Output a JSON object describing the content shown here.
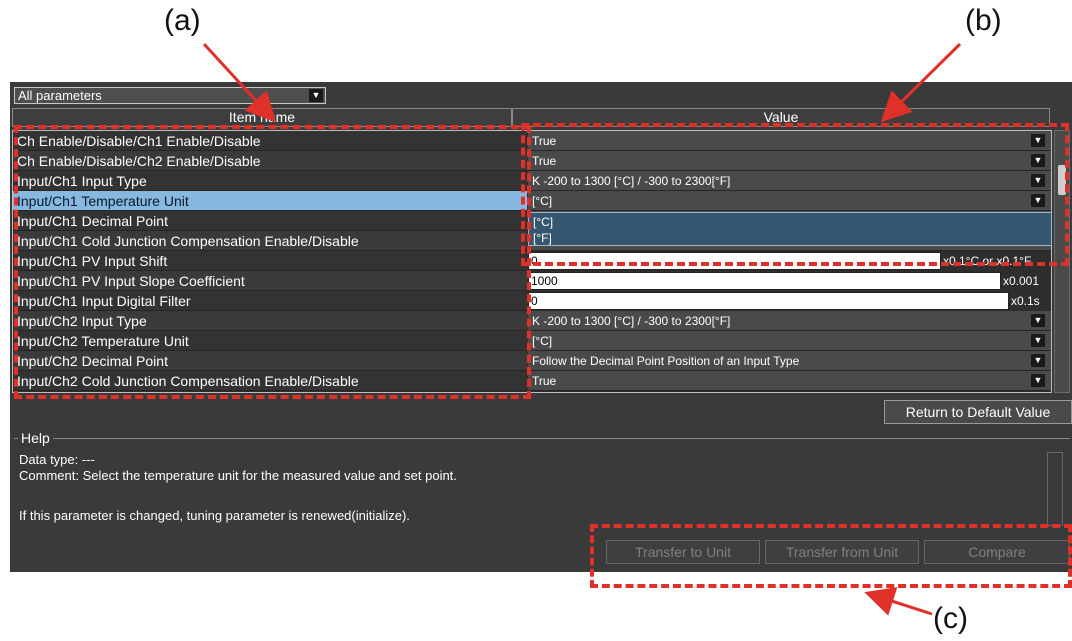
{
  "callouts": {
    "a": "(a)",
    "b": "(b)",
    "c": "(c)"
  },
  "filter": {
    "value": "All parameters",
    "arrow_icon": "chevron-down-icon"
  },
  "columns": {
    "item_name": "Item name",
    "value": "Value"
  },
  "rows": [
    {
      "name": "Ch Enable/Disable/Ch1 Enable/Disable",
      "value": "True",
      "kind": "dropdown"
    },
    {
      "name": "Ch Enable/Disable/Ch2 Enable/Disable",
      "value": "True",
      "kind": "dropdown"
    },
    {
      "name": "Input/Ch1 Input Type",
      "value": "K -200 to 1300 [°C] / -300 to 2300[°F]",
      "kind": "dropdown"
    },
    {
      "name": "Input/Ch1 Temperature Unit",
      "value": "[°C]",
      "kind": "dropdown",
      "selected": true
    },
    {
      "name": "Input/Ch1 Decimal Point",
      "value": "",
      "kind": "hidden"
    },
    {
      "name": "Input/Ch1 Cold Junction Compensation Enable/Disable",
      "value": "",
      "kind": "hidden"
    },
    {
      "name": "Input/Ch1 PV Input Shift",
      "value": "0",
      "kind": "input",
      "unit": "x0.1°C or x0.1°F"
    },
    {
      "name": "Input/Ch1 PV Input Slope Coefficient",
      "value": "1000",
      "kind": "input",
      "unit": "x0.001"
    },
    {
      "name": "Input/Ch1 Input Digital Filter",
      "value": "0",
      "kind": "input",
      "unit": "x0.1s"
    },
    {
      "name": "Input/Ch2 Input Type",
      "value": "K -200 to 1300 [°C] / -300 to 2300[°F]",
      "kind": "dropdown"
    },
    {
      "name": "Input/Ch2 Temperature Unit",
      "value": "[°C]",
      "kind": "dropdown"
    },
    {
      "name": "Input/Ch2 Decimal Point",
      "value": "Follow the Decimal Point Position of an Input Type",
      "kind": "dropdown"
    },
    {
      "name": "Input/Ch2 Cold Junction Compensation Enable/Disable",
      "value": "True",
      "kind": "dropdown"
    }
  ],
  "popup_options": [
    "[°C]",
    "[°F]"
  ],
  "buttons": {
    "return_default": "Return to Default Value",
    "transfer_to_unit": "Transfer to Unit",
    "transfer_from_unit": "Transfer from Unit",
    "compare": "Compare"
  },
  "help": {
    "title": "Help",
    "data_type": "Data type: ---",
    "comment": "Comment: Select the temperature unit for the measured value and set point.",
    "note": "If this parameter is changed, tuning parameter is renewed(initialize)."
  },
  "colors": {
    "panel_bg": "#3a3a3a",
    "selected_row": "#86b8e0",
    "highlight_dash": "#e0302a"
  }
}
